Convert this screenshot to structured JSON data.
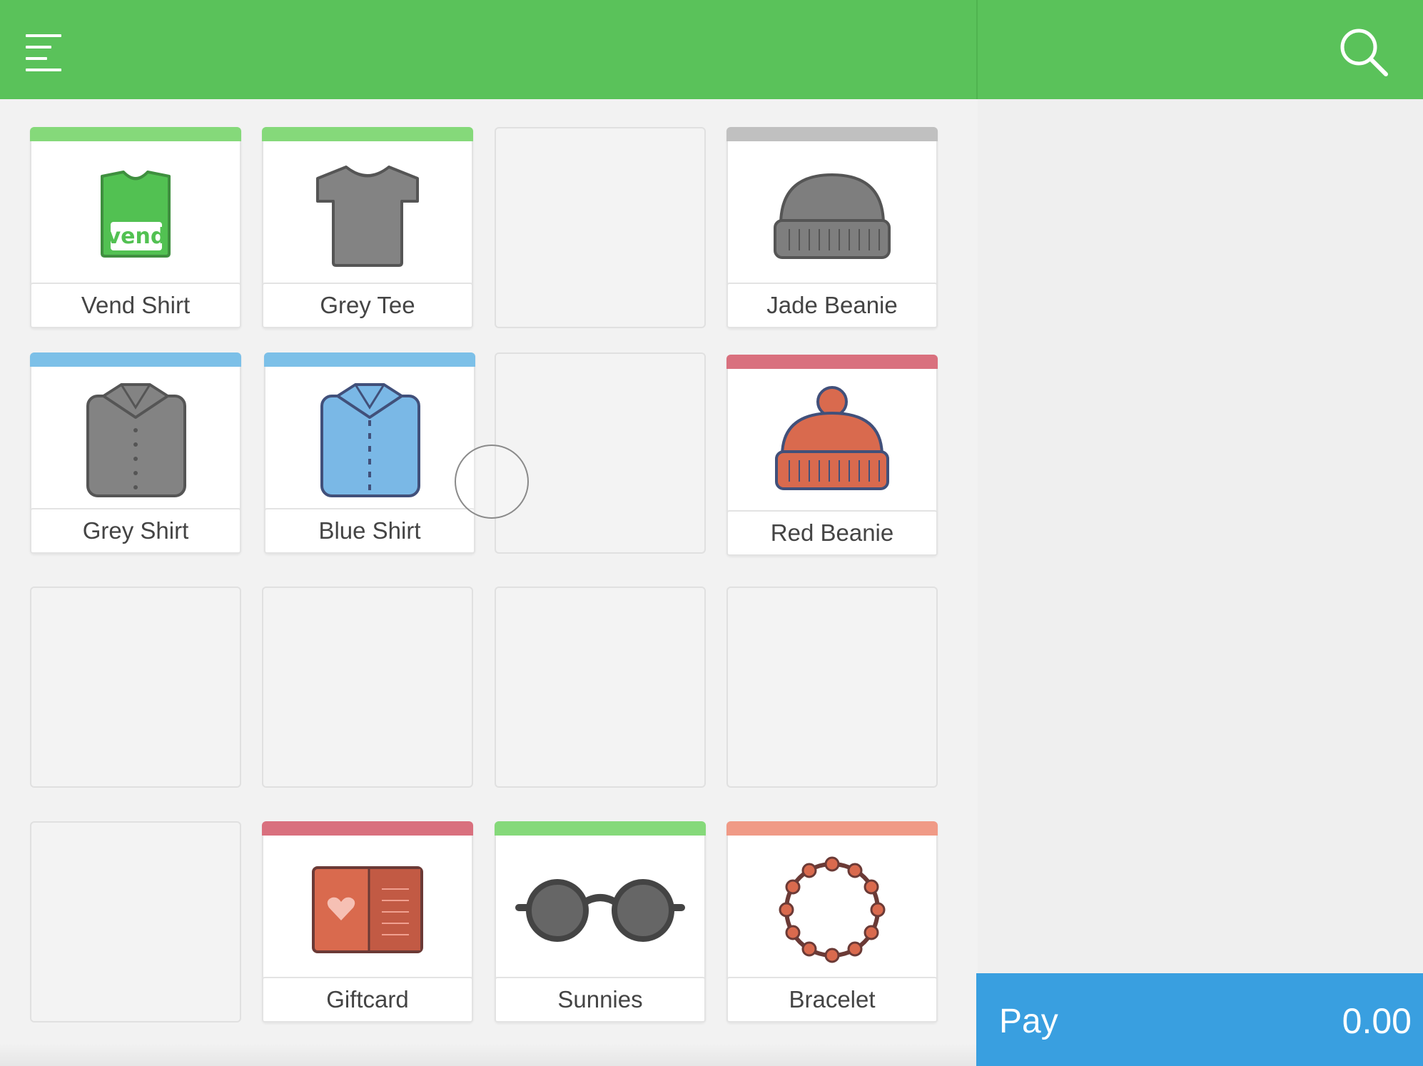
{
  "colors": {
    "header": "#5ac25a",
    "pay_button": "#399fe0",
    "stripe_green": "#85d97a",
    "stripe_grey": "#c0c0c0",
    "stripe_blue": "#7cc0e8",
    "stripe_red": "#d9707e",
    "stripe_salmon": "#f09a86"
  },
  "header": {
    "menu_icon": "hamburger-menu-icon",
    "search_icon": "search-icon"
  },
  "products": {
    "vend_shirt": {
      "name": "Vend Shirt",
      "icon": "green-tshirt-icon",
      "logo_text": "vend"
    },
    "grey_tee": {
      "name": "Grey Tee",
      "icon": "grey-tshirt-icon"
    },
    "jade_beanie": {
      "name": "Jade Beanie",
      "icon": "beanie-icon"
    },
    "grey_shirt": {
      "name": "Grey Shirt",
      "icon": "grey-shirt-icon"
    },
    "blue_shirt": {
      "name": "Blue Shirt",
      "icon": "blue-shirt-icon"
    },
    "red_beanie": {
      "name": "Red Beanie",
      "icon": "bobble-beanie-icon"
    },
    "giftcard": {
      "name": "Giftcard",
      "icon": "giftcard-icon"
    },
    "sunnies": {
      "name": "Sunnies",
      "icon": "sunglasses-icon"
    },
    "bracelet": {
      "name": "Bracelet",
      "icon": "bracelet-icon"
    }
  },
  "pay": {
    "label": "Pay",
    "amount": "0.00"
  }
}
